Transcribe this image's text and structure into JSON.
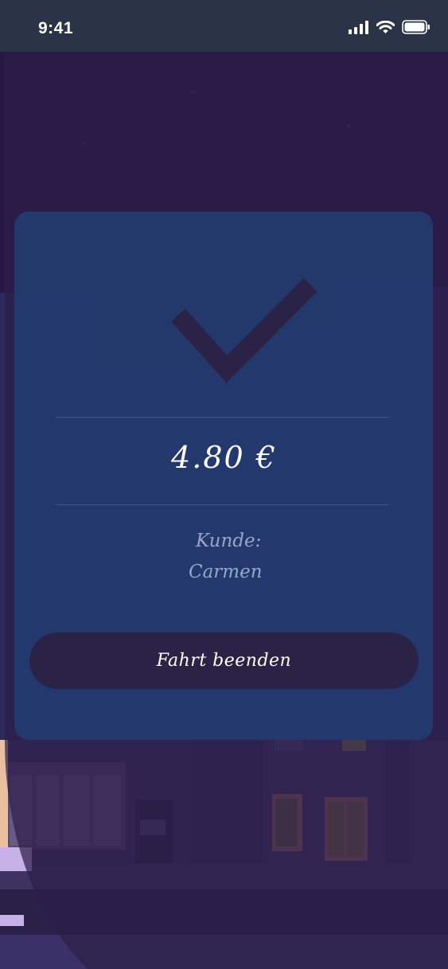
{
  "status_bar": {
    "time": "9:41"
  },
  "icons": {
    "signal": "signal-bars-icon",
    "wifi": "wifi-icon",
    "battery": "battery-icon",
    "success": "checkmark-icon"
  },
  "payment": {
    "amount": "4.80 €",
    "customer_label": "Kunde:",
    "customer_name": "Carmen"
  },
  "actions": {
    "end_ride_label": "Fahrt beenden"
  },
  "colors": {
    "status_bar_bg": "#2b3447",
    "sky": "#271841",
    "card": "#233c70",
    "check": "#2a2346",
    "button": "#2a2346"
  }
}
